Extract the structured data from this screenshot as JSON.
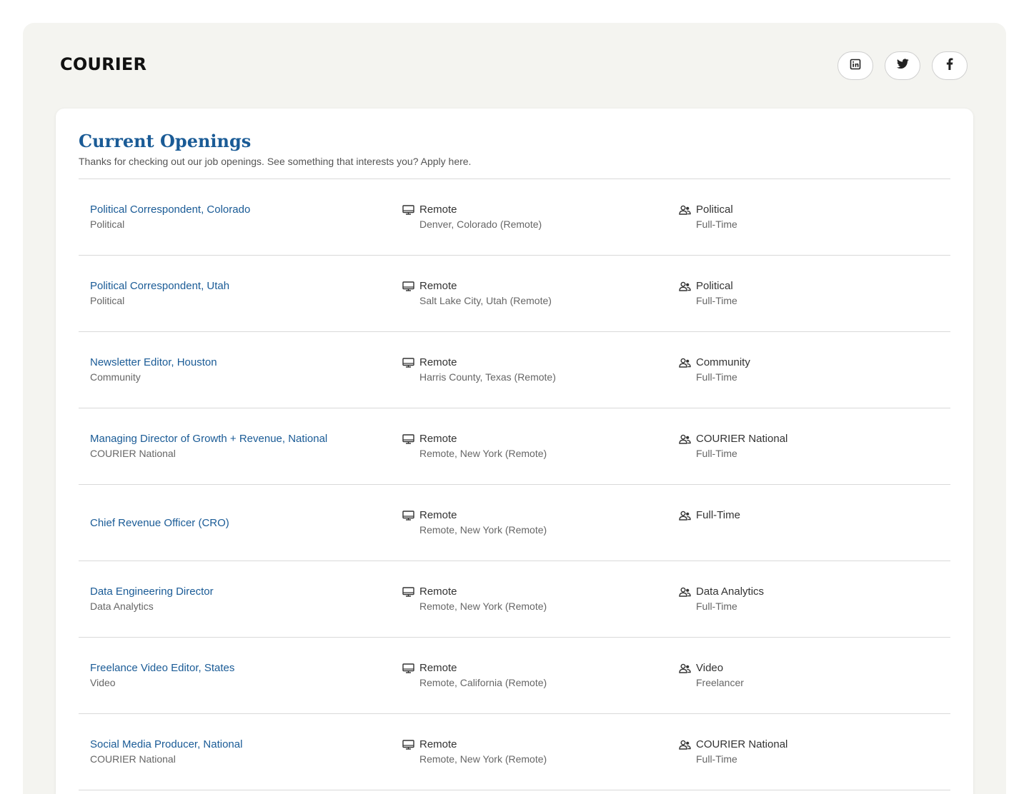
{
  "brand": {
    "logo": "COURIER"
  },
  "socials": [
    {
      "icon": "linkedin-icon"
    },
    {
      "icon": "twitter-icon"
    },
    {
      "icon": "facebook-icon"
    }
  ],
  "header": {
    "title": "Current Openings",
    "subtitle": "Thanks for checking out our job openings. See something that interests you? Apply here."
  },
  "jobs": [
    {
      "title": "Political Correspondent, Colorado",
      "department": "Political",
      "workplace": "Remote",
      "location": "Denver, Colorado (Remote)",
      "team": "Political",
      "type": "Full-Time"
    },
    {
      "title": "Political Correspondent, Utah",
      "department": "Political",
      "workplace": "Remote",
      "location": "Salt Lake City, Utah (Remote)",
      "team": "Political",
      "type": "Full-Time"
    },
    {
      "title": "Newsletter Editor, Houston",
      "department": "Community",
      "workplace": "Remote",
      "location": "Harris County, Texas (Remote)",
      "team": "Community",
      "type": "Full-Time"
    },
    {
      "title": "Managing Director of Growth + Revenue, National",
      "department": "COURIER National",
      "workplace": "Remote",
      "location": "Remote, New York (Remote)",
      "team": "COURIER National",
      "type": "Full-Time"
    },
    {
      "title": "Chief Revenue Officer (CRO)",
      "department": "",
      "workplace": "Remote",
      "location": "Remote, New York (Remote)",
      "team": "Full-Time",
      "type": ""
    },
    {
      "title": "Data Engineering Director",
      "department": "Data Analytics",
      "workplace": "Remote",
      "location": "Remote, New York (Remote)",
      "team": "Data Analytics",
      "type": "Full-Time"
    },
    {
      "title": "Freelance Video Editor, States",
      "department": "Video",
      "workplace": "Remote",
      "location": "Remote, California (Remote)",
      "team": "Video",
      "type": "Freelancer"
    },
    {
      "title": "Social Media Producer, National",
      "department": "COURIER National",
      "workplace": "Remote",
      "location": "Remote, New York (Remote)",
      "team": "COURIER National",
      "type": "Full-Time"
    }
  ],
  "icons": {
    "workplace": "monitor-icon",
    "team": "people-icon"
  },
  "colors": {
    "accent": "#1a5b96",
    "background": "#f4f4f0"
  }
}
